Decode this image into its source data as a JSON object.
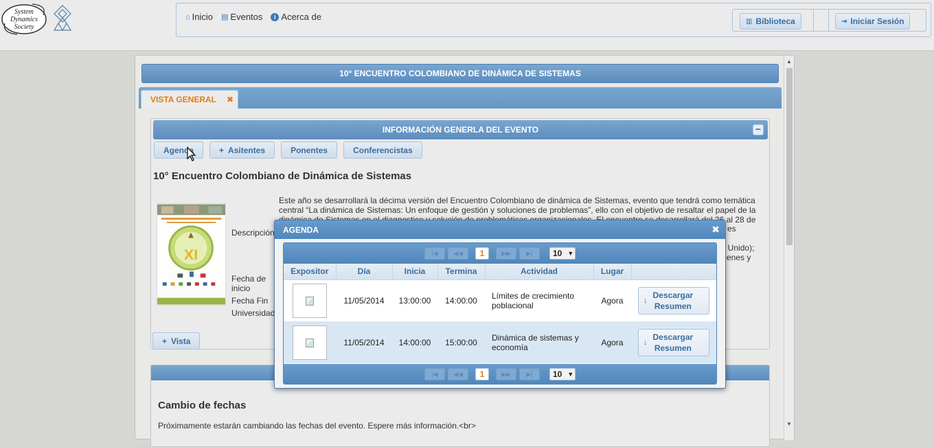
{
  "logo": {
    "line1": "System",
    "line2": "Dynamics",
    "line3": "Society"
  },
  "nav": {
    "links": [
      {
        "label": "Inicio",
        "icon": "home-icon"
      },
      {
        "label": "Eventos",
        "icon": "calendar-icon"
      },
      {
        "label": "Acerca de",
        "icon": "info-icon"
      }
    ],
    "biblioteca": "Biblioteca",
    "login": "Iniciar Sesión"
  },
  "event_title": "10° ENCUENTRO COLOMBIANO DE DINÁMICA DE SISTEMAS",
  "tab": {
    "label": "VISTA GENERAL",
    "close": "✖"
  },
  "info": {
    "header": "INFORMACIÓN GENERLA DEL EVENTO",
    "collapse": "−",
    "buttons": [
      "Agenda",
      "Asitentes",
      "Ponentes",
      "Conferencistas"
    ],
    "event_name": "10° Encuentro Colombiano de Dinámica de Sistemas",
    "labels": {
      "descripcion": "Descripción",
      "fecha_inicio_1": "Fecha de",
      "fecha_inicio_2": "inicio",
      "fecha_fin": "Fecha Fin",
      "universidad": "Universidad"
    },
    "description": "Este año se desarrollará la décima versión del Encuentro Colombiano de dinámica de Sistemas, evento que tendrá como temática central “La dinámica de Sistemas: Un enfoque de gestión y soluciones de problemas”, ello con el objetivo de resaltar el papel de la dinámica de Sistemas en el diagnostico y solución de problemáticas organizacionales. El encuentro se desarrollará del 26 al 28 de",
    "desc_tail_1": "es",
    "desc_tail_2": "no Unido);",
    "desc_tail_3": "menes y",
    "vista_button": "Vista"
  },
  "news": {
    "title": "Cambio de fechas",
    "text": "Próximamente estarán cambiando las fechas del evento. Espere más información.<br>"
  },
  "dialog": {
    "title": "AGENDA",
    "close": "✖",
    "pager": {
      "first": "|◀",
      "prev": "◀◀",
      "page": "1",
      "next": "▶▶",
      "last": "▶|",
      "rows": "10",
      "caret": "▼"
    },
    "columns": [
      "Expositor",
      "Día",
      "Inicia",
      "Termina",
      "Actividad",
      "Lugar",
      ""
    ],
    "rows": [
      {
        "dia": "11/05/2014",
        "inicia": "13:00:00",
        "termina": "14:00:00",
        "actividad_1": "Límites de crecimiento",
        "actividad_2": "poblacional",
        "lugar": "Agora",
        "btn_1": "Descargar",
        "btn_2": "Resumen"
      },
      {
        "dia": "11/05/2014",
        "inicia": "14:00:00",
        "termina": "15:00:00",
        "actividad_1": "Dinámica de sistemas y",
        "actividad_2": "economía",
        "lugar": "Agora",
        "btn_1": "Descargar",
        "btn_2": "Resumen"
      }
    ]
  },
  "colors": {
    "header_blue": "#5b8dbe",
    "accent_orange": "#e07d18",
    "button_text": "#3a6d9e"
  }
}
